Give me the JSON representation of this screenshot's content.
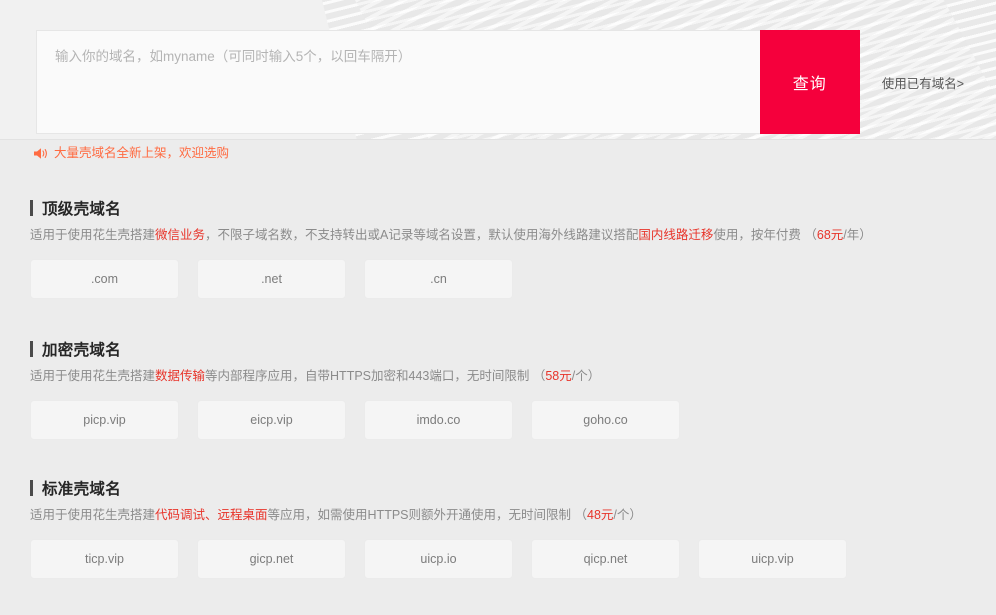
{
  "search": {
    "placeholder": "输入你的域名，如myname（可同时输入5个，以回车隔开）",
    "value": "",
    "button_label": "查询",
    "existing_domain_link": "使用已有域名>"
  },
  "notice": {
    "icon": "megaphone-icon",
    "text": "大量壳域名全新上架，欢迎选购",
    "color": "#ff6b42"
  },
  "theme": {
    "accent": "#f5003c",
    "highlight": "#e8342a",
    "body_bg": "#ececec",
    "chip_bg": "#f5f5f5"
  },
  "sections": [
    {
      "title": "顶级壳域名",
      "desc_parts": [
        {
          "text": "适用于使用花生壳搭建",
          "highlight": false
        },
        {
          "text": "微信业务",
          "highlight": true
        },
        {
          "text": "，不限子域名数，不支持转出或A记录等域名设置，默认使用海外线路建议搭配",
          "highlight": false
        },
        {
          "text": "国内线路迁移",
          "highlight": true
        },
        {
          "text": "使用，按年付费",
          "highlight": false
        }
      ],
      "price": "68元",
      "price_unit": "/年",
      "chips": [
        ".com",
        ".net",
        ".cn"
      ]
    },
    {
      "title": "加密壳域名",
      "desc_parts": [
        {
          "text": "适用于使用花生壳搭建",
          "highlight": false
        },
        {
          "text": "数据传输",
          "highlight": true
        },
        {
          "text": "等内部程序应用，自带HTTPS加密和443端口，无时间限制",
          "highlight": false
        }
      ],
      "price": "58元",
      "price_unit": "/个",
      "chips": [
        "picp.vip",
        "eicp.vip",
        "imdo.co",
        "goho.co"
      ]
    },
    {
      "title": "标准壳域名",
      "desc_parts": [
        {
          "text": "适用于使用花生壳搭建",
          "highlight": false
        },
        {
          "text": "代码调试、远程桌面",
          "highlight": true
        },
        {
          "text": "等应用，如需使用HTTPS则额外开通使用，无时间限制",
          "highlight": false
        }
      ],
      "price": "48元",
      "price_unit": "/个",
      "chips": [
        "ticp.vip",
        "gicp.net",
        "uicp.io",
        "qicp.net",
        "uicp.vip"
      ]
    }
  ]
}
